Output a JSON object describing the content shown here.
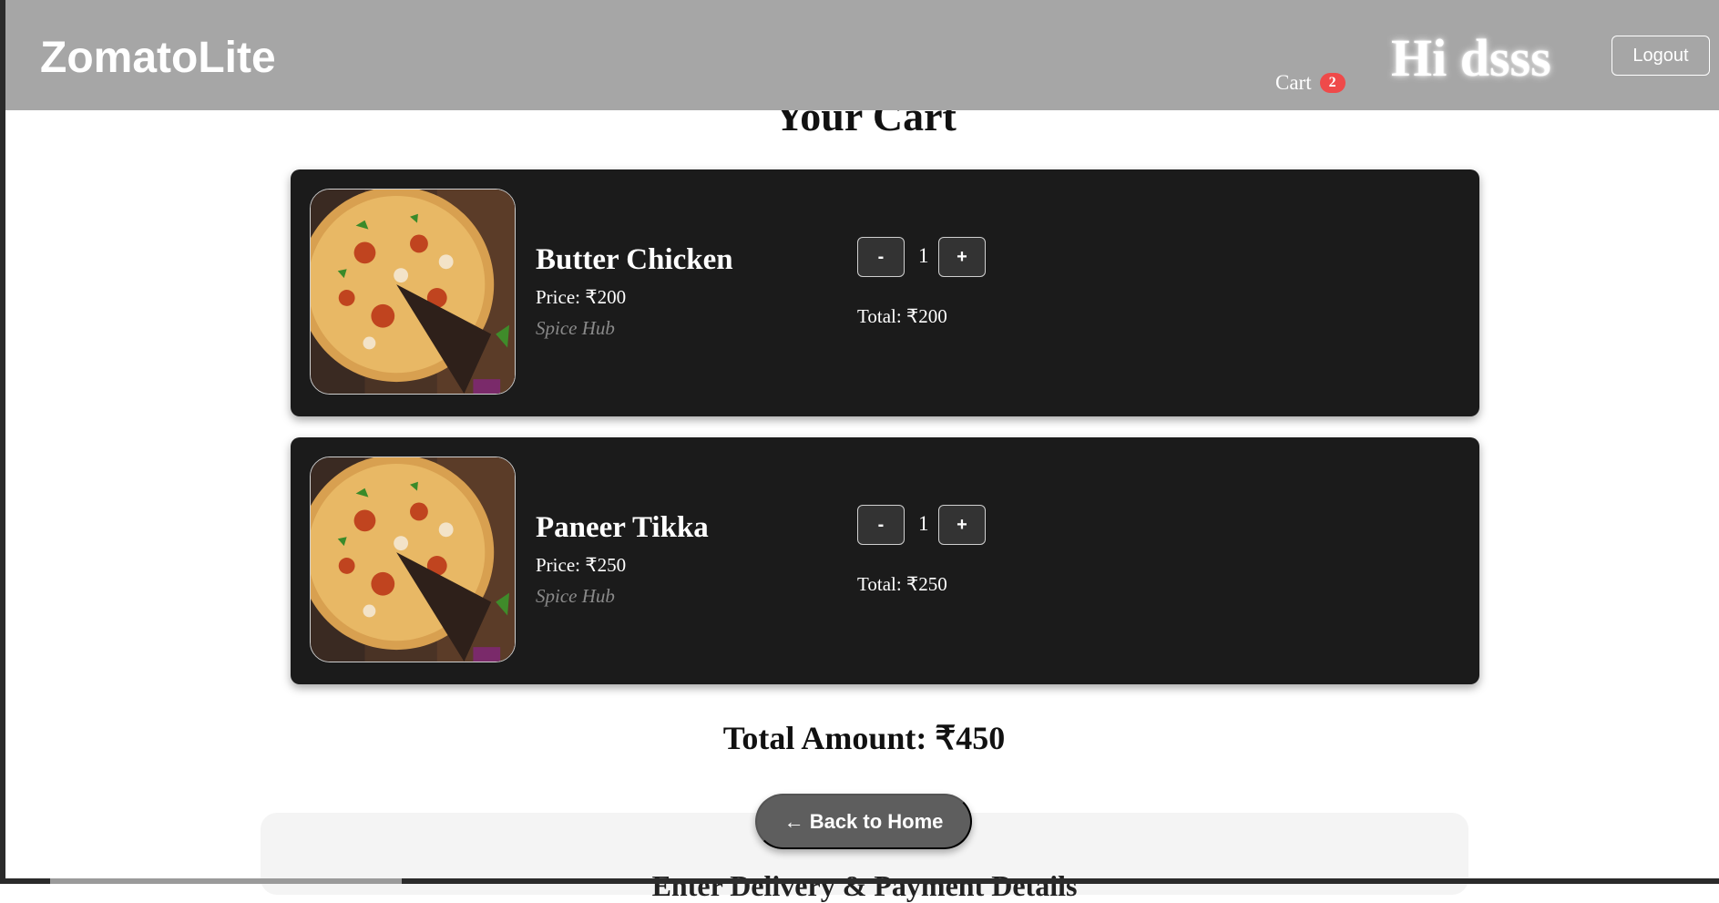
{
  "header": {
    "brand": "ZomatoLite",
    "cart_label": "Cart",
    "cart_count": "2",
    "greeting": "Hi dsss",
    "logout_label": "Logout"
  },
  "page_title": "Your Cart",
  "cart_items": [
    {
      "name": "Butter Chicken",
      "price": "Price: ₹200",
      "restaurant": "Spice Hub",
      "minus_label": "-",
      "quantity": "1",
      "plus_label": "+",
      "total": "Total: ₹200",
      "image_icon": "pizza-image"
    },
    {
      "name": "Paneer Tikka",
      "price": "Price: ₹250",
      "restaurant": "Spice Hub",
      "minus_label": "-",
      "quantity": "1",
      "plus_label": "+",
      "total": "Total: ₹250",
      "image_icon": "pizza-image"
    }
  ],
  "total_amount": "Total Amount: ₹450",
  "back_button_label": "← Back to Home",
  "lower_section_heading": "Enter Delivery & Payment Details",
  "colors": {
    "header_bg": "#a6a6a6",
    "card_bg": "#1b1b1b",
    "badge": "#ef4a4a",
    "back_button": "#5e5e5e"
  }
}
